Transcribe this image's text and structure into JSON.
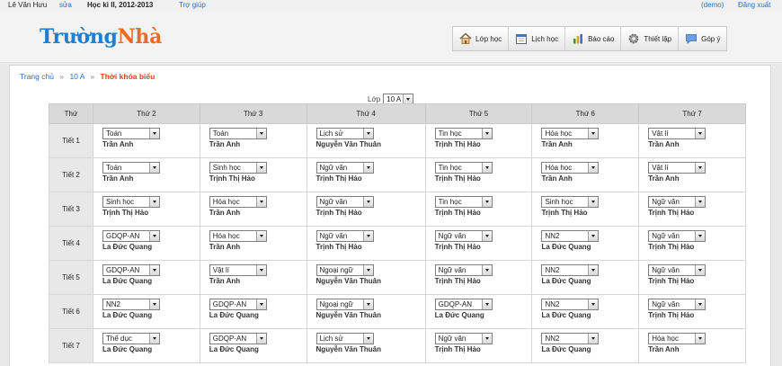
{
  "topbar": {
    "user": "Lê Văn Hưu",
    "edit": "sửa",
    "term": "Học kì II, 2012-2013",
    "help": "Trợ giúp",
    "demo": "(demo)",
    "logout": "Đăng xuất"
  },
  "logo": {
    "part1": "Trường",
    "part2": "Nhà"
  },
  "nav": {
    "classes": {
      "label": "Lớp học",
      "icon": "house-icon"
    },
    "study": {
      "label": "Lịch học",
      "icon": "calendar-icon"
    },
    "reports": {
      "label": "Báo cáo",
      "icon": "bar-chart-icon"
    },
    "settings": {
      "label": "Thiết lập",
      "icon": "gear-icon"
    },
    "feedback": {
      "label": "Góp ý",
      "icon": "chat-icon"
    }
  },
  "breadcrumb": {
    "home": "Trang chủ",
    "class": "10 A",
    "separator": "»",
    "current": "Thời khóa biểu"
  },
  "class_select": {
    "label": "Lớp",
    "value": "10 A"
  },
  "timetable": {
    "corner": "Thứ",
    "days": [
      "Thứ 2",
      "Thứ 3",
      "Thứ 4",
      "Thứ 5",
      "Thứ 6",
      "Thứ 7"
    ],
    "rows": [
      {
        "period": "Tiết 1",
        "cells": [
          {
            "subject": "Toán",
            "teacher": "Trần Anh"
          },
          {
            "subject": "Toán",
            "teacher": "Trần Anh"
          },
          {
            "subject": "Lịch sử",
            "teacher": "Nguyễn Văn Thuân"
          },
          {
            "subject": "Tin học",
            "teacher": "Trịnh Thị Hảo"
          },
          {
            "subject": "Hóa học",
            "teacher": "Trần Anh"
          },
          {
            "subject": "Vật lí",
            "teacher": "Trần Anh"
          }
        ]
      },
      {
        "period": "Tiết 2",
        "cells": [
          {
            "subject": "Toán",
            "teacher": "Trần Anh"
          },
          {
            "subject": "Sinh học",
            "teacher": "Trịnh Thị Hảo"
          },
          {
            "subject": "Ngữ văn",
            "teacher": "Trịnh Thị Hảo"
          },
          {
            "subject": "Tin học",
            "teacher": "Trịnh Thị Hảo"
          },
          {
            "subject": "Hóa học",
            "teacher": "Trần Anh"
          },
          {
            "subject": "Vật lí",
            "teacher": "Trần Anh"
          }
        ]
      },
      {
        "period": "Tiết 3",
        "cells": [
          {
            "subject": "Sinh học",
            "teacher": "Trịnh Thị Hảo"
          },
          {
            "subject": "Hóa học",
            "teacher": "Trần Anh"
          },
          {
            "subject": "Ngữ văn",
            "teacher": "Trịnh Thị Hảo"
          },
          {
            "subject": "Tin học",
            "teacher": "Trịnh Thị Hảo"
          },
          {
            "subject": "Sinh học",
            "teacher": "Trịnh Thị Hảo"
          },
          {
            "subject": "Ngữ văn",
            "teacher": "Trịnh Thị Hảo"
          }
        ]
      },
      {
        "period": "Tiết 4",
        "cells": [
          {
            "subject": "GDQP-AN",
            "teacher": "La Đức Quang"
          },
          {
            "subject": "Hóa học",
            "teacher": "Trần Anh"
          },
          {
            "subject": "Ngữ văn",
            "teacher": "Trịnh Thị Hảo"
          },
          {
            "subject": "Ngữ văn",
            "teacher": "Trịnh Thị Hảo"
          },
          {
            "subject": "NN2",
            "teacher": "La Đức Quang"
          },
          {
            "subject": "Ngữ văn",
            "teacher": "Trịnh Thị Hảo"
          }
        ]
      },
      {
        "period": "Tiết 5",
        "cells": [
          {
            "subject": "GDQP-AN",
            "teacher": "La Đức Quang"
          },
          {
            "subject": "Vật lí",
            "teacher": "Trần Anh"
          },
          {
            "subject": "Ngoại ngữ",
            "teacher": "Nguyễn Văn Thuân"
          },
          {
            "subject": "Ngữ văn",
            "teacher": "Trịnh Thị Hảo"
          },
          {
            "subject": "NN2",
            "teacher": "La Đức Quang"
          },
          {
            "subject": "Ngữ văn",
            "teacher": "Trịnh Thị Hảo"
          }
        ]
      },
      {
        "period": "Tiết 6",
        "cells": [
          {
            "subject": "NN2",
            "teacher": "La Đức Quang"
          },
          {
            "subject": "GDQP-AN",
            "teacher": "La Đức Quang"
          },
          {
            "subject": "Ngoại ngữ",
            "teacher": "Nguyễn Văn Thuân"
          },
          {
            "subject": "GDQP-AN",
            "teacher": "La Đức Quang"
          },
          {
            "subject": "NN2",
            "teacher": "La Đức Quang"
          },
          {
            "subject": "Ngữ văn",
            "teacher": "Trịnh Thị Hảo"
          }
        ]
      },
      {
        "period": "Tiết 7",
        "cells": [
          {
            "subject": "Thể dục",
            "teacher": "La Đức Quang"
          },
          {
            "subject": "GDQP-AN",
            "teacher": "La Đức Quang"
          },
          {
            "subject": "Lịch sử",
            "teacher": "Nguyễn Văn Thuân"
          },
          {
            "subject": "Ngữ văn",
            "teacher": "Trịnh Thị Hảo"
          },
          {
            "subject": "NN2",
            "teacher": "La Đức Quang"
          },
          {
            "subject": "Hóa học",
            "teacher": "Trần Anh"
          }
        ]
      }
    ]
  },
  "colors": {
    "link": "#2a6fc0",
    "logo_blue": "#1e7fd0",
    "logo_orange": "#ef6a22",
    "breadcrumb_current": "#e0431a",
    "table_header_bg": "#d9d9d9"
  }
}
